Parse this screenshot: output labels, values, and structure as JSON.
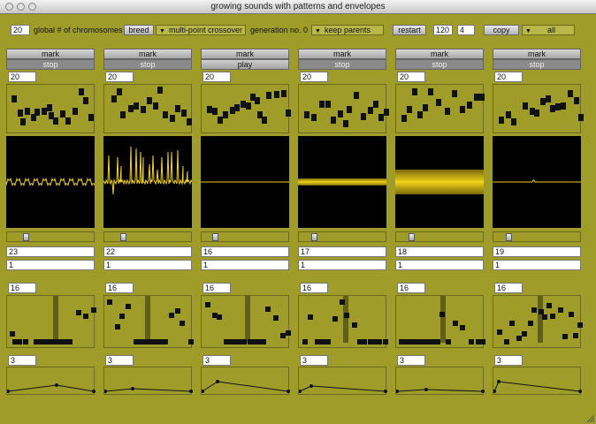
{
  "window": {
    "title": "growing sounds with patterns and envelopes"
  },
  "toolbar": {
    "chromosomes_value": "20",
    "chromosomes_label": "global # of chromosomes",
    "breed_label": "breed",
    "crossover_value": "multi-point crossover",
    "generation_label": "generation no. 0",
    "keep_parents_value": "keep parents",
    "restart_label": "restart",
    "value_a": "120",
    "value_b": "4",
    "copy_label": "copy",
    "all_value": "all"
  },
  "voices": [
    {
      "mark": "mark",
      "action": "stop",
      "count": "20",
      "field1": "23",
      "field2": "1",
      "env_count": "16",
      "shape_count": "3"
    },
    {
      "mark": "mark",
      "action": "stop",
      "count": "20",
      "field1": "22",
      "field2": "1",
      "env_count": "16",
      "shape_count": "3"
    },
    {
      "mark": "mark",
      "action": "play",
      "count": "20",
      "field1": "16",
      "field2": "1",
      "env_count": "16",
      "shape_count": "3"
    },
    {
      "mark": "mark",
      "action": "stop",
      "count": "20",
      "field1": "17",
      "field2": "1",
      "env_count": "16",
      "shape_count": "3"
    },
    {
      "mark": "mark",
      "action": "stop",
      "count": "20",
      "field1": "18",
      "field2": "1",
      "env_count": "16",
      "shape_count": "3"
    },
    {
      "mark": "mark",
      "action": "stop",
      "count": "20",
      "field1": "19",
      "field2": "1",
      "env_count": "16",
      "shape_count": "3"
    }
  ],
  "colors": {
    "background": "#9f9c2a",
    "waveform": "#f2d21a",
    "panel": "#000000"
  }
}
